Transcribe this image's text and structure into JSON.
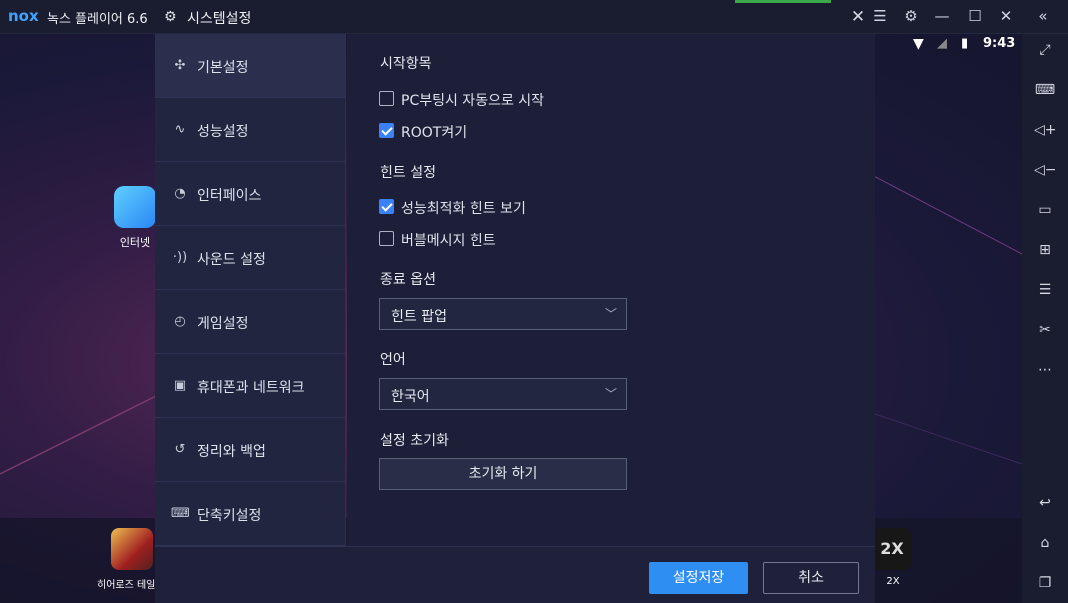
{
  "emulator": {
    "logo_text": "nox",
    "app_title": "녹스 플레이어 6.6",
    "clock": "9:43",
    "accent_color": "#2f8ef2"
  },
  "desktop": {
    "internet_label": "인터넷",
    "heroes_label": "히어로즈 테일즈",
    "speed_label": "2X",
    "speed_icon_text": "2X"
  },
  "dialog": {
    "title": "시스템설정",
    "nav": [
      {
        "label": "기본설정",
        "icon": "puzzle-icon"
      },
      {
        "label": "성능설정",
        "icon": "pulse-icon"
      },
      {
        "label": "인터페이스",
        "icon": "palette-icon"
      },
      {
        "label": "사운드 설정",
        "icon": "sound-icon"
      },
      {
        "label": "게임설정",
        "icon": "gauge-icon"
      },
      {
        "label": "휴대폰과 네트워크",
        "icon": "phone-wifi-icon"
      },
      {
        "label": "정리와 백업",
        "icon": "history-icon"
      },
      {
        "label": "단축키설정",
        "icon": "keyboard-icon"
      }
    ],
    "active_nav": "기본설정",
    "startup": {
      "title": "시작항목",
      "autostart_label": "PC부팅시 자동으로 시작",
      "autostart_checked": false,
      "root_label": "ROOT켜기",
      "root_checked": true
    },
    "hints": {
      "title": "힌트 설정",
      "perf_hint_label": "성능최적화 힌트 보기",
      "perf_hint_checked": true,
      "bubble_label": "버블메시지 힌트",
      "bubble_checked": false
    },
    "exit_option": {
      "title": "종료 옵션",
      "value": "힌트 팝업"
    },
    "language": {
      "title": "언어",
      "value": "한국어"
    },
    "reset": {
      "title": "설정 초기화",
      "button_label": "초기화 하기"
    },
    "save_label": "설정저장",
    "cancel_label": "취소"
  }
}
